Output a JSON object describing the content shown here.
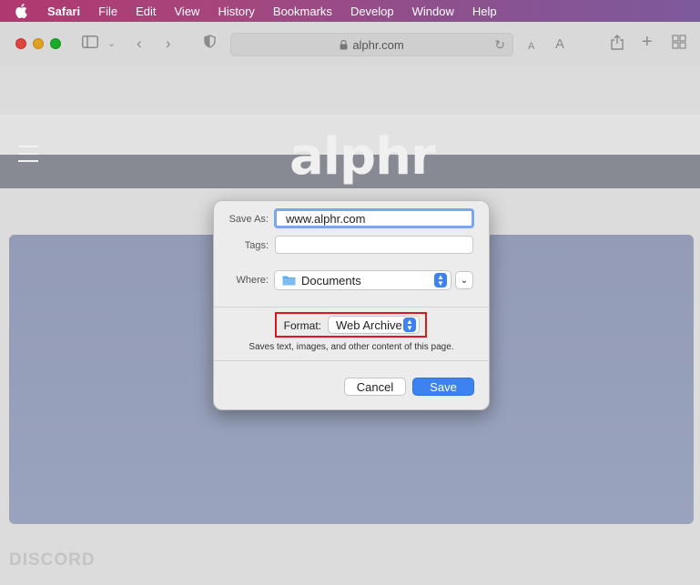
{
  "menubar": {
    "items": [
      "Safari",
      "File",
      "Edit",
      "View",
      "History",
      "Bookmarks",
      "Develop",
      "Window",
      "Help"
    ]
  },
  "toolbar": {
    "url": "alphr.com",
    "font_small": "A",
    "font_large": "A"
  },
  "page": {
    "logo": "alphr",
    "footer_brand": "DISCORD"
  },
  "dialog": {
    "save_as_label": "Save As:",
    "save_as_value": "www.alphr.com",
    "tags_label": "Tags:",
    "where_label": "Where:",
    "where_value": "Documents",
    "format_label": "Format:",
    "format_value": "Web Archive",
    "format_description": "Saves text, images, and other content of this page.",
    "cancel_label": "Cancel",
    "save_label": "Save"
  },
  "colors": {
    "accent": "#3c82f0",
    "highlight": "#e0161b"
  }
}
